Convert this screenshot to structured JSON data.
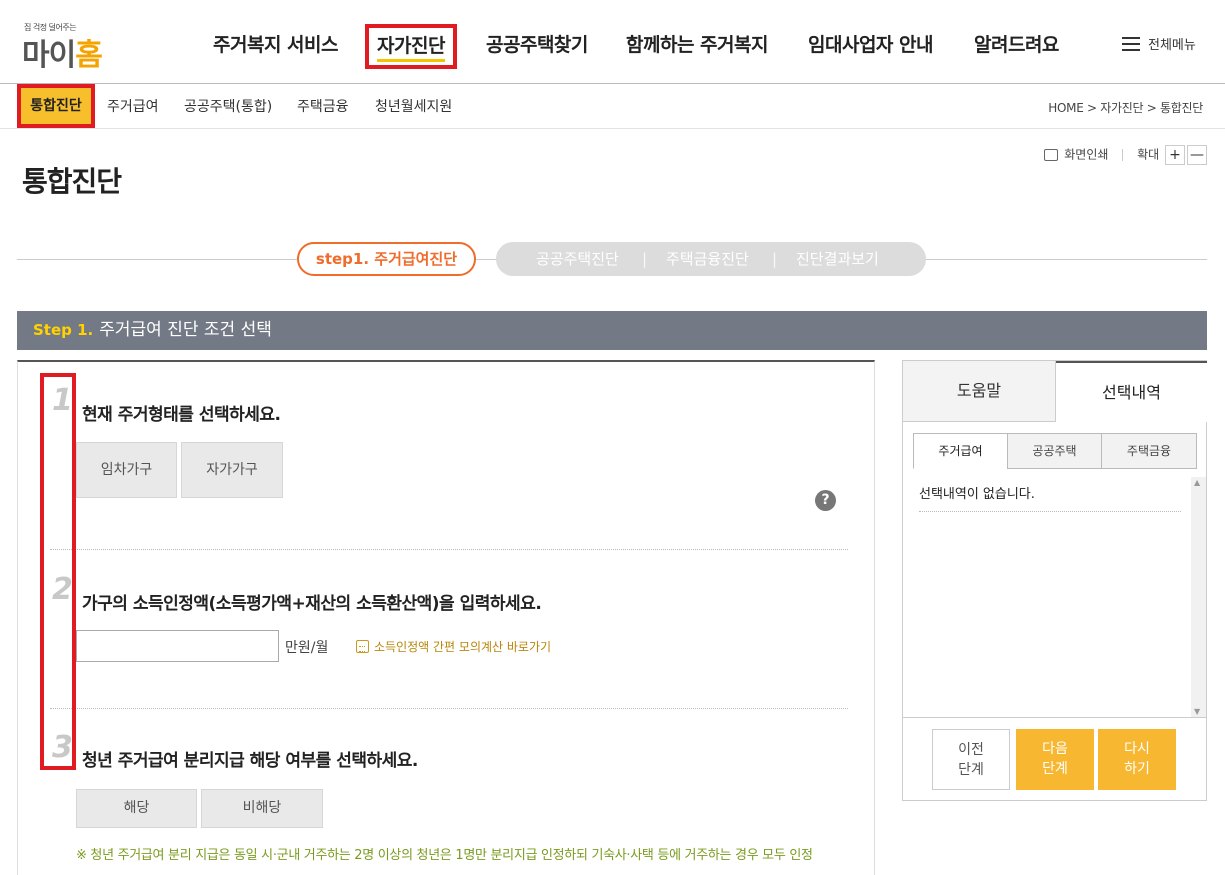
{
  "logo": {
    "tagline": "집 걱정 덜어주는",
    "main_part1": "마이",
    "main_part2": "홈"
  },
  "gnb": {
    "items": [
      "주거복지 서비스",
      "자가진단",
      "공공주택찾기",
      "함께하는 주거복지",
      "임대사업자 안내",
      "알려드려요"
    ],
    "all_menu": "전체메뉴"
  },
  "subnav": {
    "items": [
      "통합진단",
      "주거급여",
      "공공주택(통합)",
      "주택금융",
      "청년월세지원"
    ],
    "breadcrumb": "HOME > 자가진단 > 통합진단"
  },
  "page": {
    "title": "통합진단"
  },
  "tools": {
    "print": "화면인쇄",
    "zoom": "확대",
    "zoom_in": "+",
    "zoom_out": "—"
  },
  "steps": {
    "active": "step1. 주거급여진단",
    "rest": [
      "공공주택진단",
      "주택금융진단",
      "진단결과보기"
    ],
    "separator": "|"
  },
  "step_heading": {
    "num": "Step 1.",
    "text": "주거급여 진단 조건 선택"
  },
  "questions": [
    {
      "num": "1",
      "text": "현재 주거형태를 선택하세요.",
      "options": [
        "임차가구",
        "자가가구"
      ]
    },
    {
      "num": "2",
      "text": "가구의 소득인정액(소득평가액+재산의 소득환산액)을 입력하세요.",
      "unit": "만원/월",
      "link": "소득인정액 간편 모의계산 바로가기",
      "input_value": ""
    },
    {
      "num": "3",
      "text": "청년 주거급여 분리지급 해당 여부를 선택하세요.",
      "options": [
        "해당",
        "비해당"
      ]
    }
  ],
  "note": "※ 청년 주거급여 분리 지급은 동일 시·군내 거주하는 2명 이상의 청년은 1명만 분리지급 인정하되 기숙사·사택 등에 거주하는 경우 모두 인정",
  "help_label": "?",
  "sidebar": {
    "tabs": [
      "도움말",
      "선택내역"
    ],
    "sub_tabs": [
      "주거급여",
      "공공주택",
      "주택금융"
    ],
    "empty": "선택내역이 없습니다.",
    "buttons": {
      "prev": "이전\n단계",
      "next": "다음\n단계",
      "reset": "다시\n하기"
    },
    "scroll_up": "▲",
    "scroll_down": "▼"
  },
  "colors": {
    "accent_red": "#e11b22",
    "accent_yellow": "#f7b731",
    "step_orange": "#ef6c2a",
    "heading_bg": "#737a86",
    "note_green": "#7a9b1e"
  }
}
